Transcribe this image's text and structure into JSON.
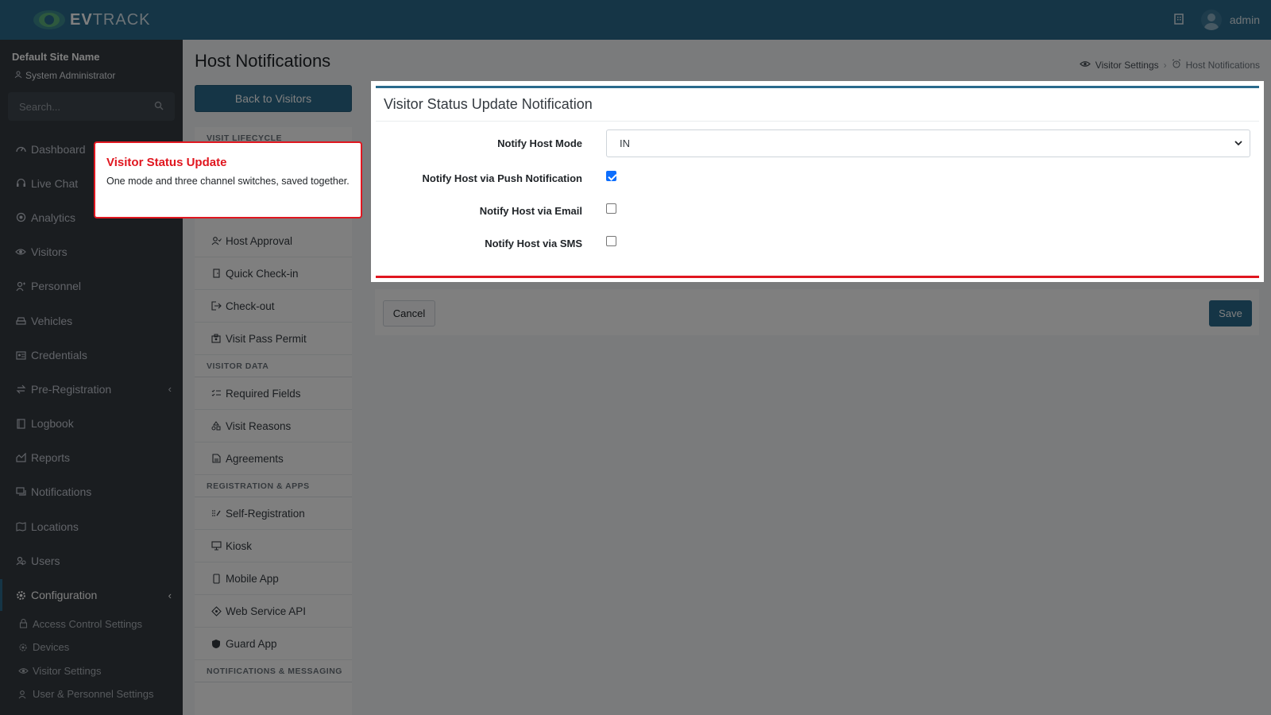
{
  "app": {
    "brand_prefix": "EV",
    "brand_suffix": "TRACK"
  },
  "topbar": {
    "username": "admin"
  },
  "sidebar": {
    "site_name": "Default Site Name",
    "role": "System Administrator",
    "search_placeholder": "Search...",
    "items": [
      {
        "label": "Dashboard"
      },
      {
        "label": "Live Chat"
      },
      {
        "label": "Analytics"
      },
      {
        "label": "Visitors"
      },
      {
        "label": "Personnel"
      },
      {
        "label": "Vehicles"
      },
      {
        "label": "Credentials"
      },
      {
        "label": "Pre-Registration"
      },
      {
        "label": "Logbook"
      },
      {
        "label": "Reports"
      },
      {
        "label": "Notifications"
      },
      {
        "label": "Locations"
      },
      {
        "label": "Users"
      },
      {
        "label": "Configuration"
      }
    ],
    "subitems": [
      {
        "label": "Access Control Settings"
      },
      {
        "label": "Devices"
      },
      {
        "label": "Visitor Settings"
      },
      {
        "label": "User & Personnel Settings"
      }
    ]
  },
  "page": {
    "title": "Host Notifications",
    "back_label": "Back to Visitors",
    "breadcrumb": [
      "Visitor Settings",
      "Host Notifications"
    ]
  },
  "settings_menu": {
    "lifecycle_header": "VISIT LIFECYCLE",
    "lifecycle": [
      "Host Approval",
      "Quick Check-in",
      "Check-out",
      "Visit Pass Permit"
    ],
    "data_header": "VISITOR DATA",
    "data": [
      "Required Fields",
      "Visit Reasons",
      "Agreements"
    ],
    "apps_header": "REGISTRATION & APPS",
    "apps": [
      "Self-Registration",
      "Kiosk",
      "Mobile App",
      "Web Service API",
      "Guard App"
    ],
    "notif_header": "NOTIFICATIONS & MESSAGING"
  },
  "card": {
    "title": "Visitor Status Update Notification",
    "mode_label": "Notify Host Mode",
    "mode_value": "IN",
    "push_label": "Notify Host via Push Notification",
    "push_checked": true,
    "email_label": "Notify Host via Email",
    "email_checked": false,
    "sms_label": "Notify Host via SMS",
    "sms_checked": false
  },
  "actions": {
    "cancel": "Cancel",
    "save": "Save"
  },
  "callout": {
    "title": "Visitor Status Update",
    "body": "One mode and three channel switches, saved together."
  },
  "colors": {
    "primary": "#2a6a8c",
    "highlight": "#e0161f",
    "sidebar": "#343a40"
  }
}
